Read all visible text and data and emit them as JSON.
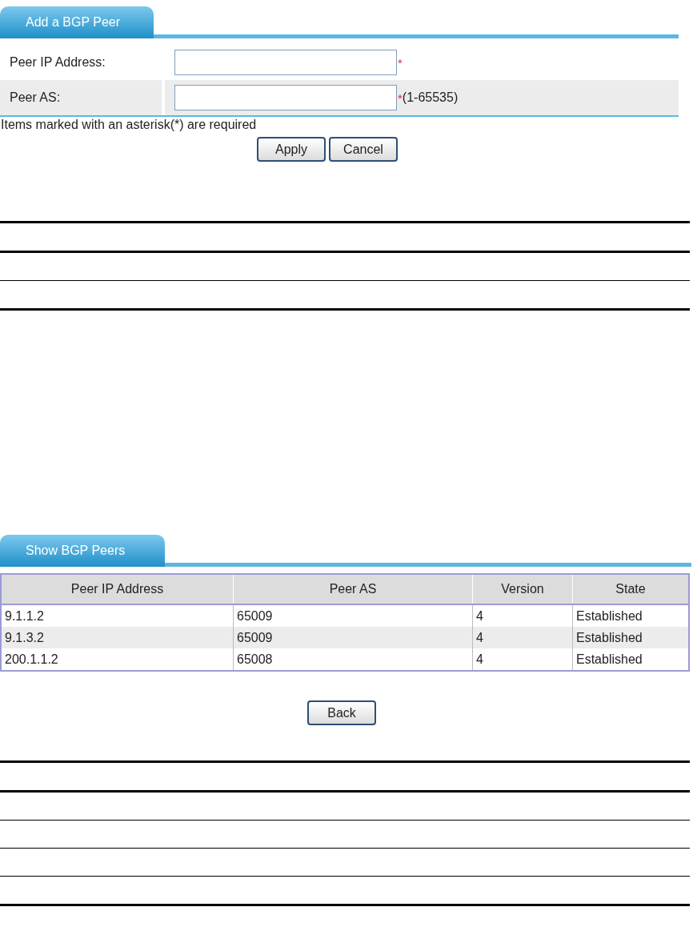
{
  "add_panel": {
    "tab": "Add a BGP Peer",
    "fields": [
      {
        "label": "Peer IP Address:",
        "required_mark": "*"
      },
      {
        "label": "Peer AS:",
        "required_mark": "*",
        "hint": "(1-65535)"
      }
    ],
    "note": "Items marked with an asterisk(*) are required",
    "buttons": [
      "Apply",
      "Cancel"
    ]
  },
  "show_panel": {
    "tab": "Show BGP Peers",
    "columns": [
      "Peer IP Address",
      "Peer AS",
      "Version",
      "State"
    ],
    "rows": [
      [
        "9.1.1.2",
        "65009",
        "4",
        "Established"
      ],
      [
        "9.1.3.2",
        "65009",
        "4",
        "Established"
      ],
      [
        "200.1.1.2",
        "65008",
        "4",
        "Established"
      ]
    ],
    "button": "Back"
  }
}
